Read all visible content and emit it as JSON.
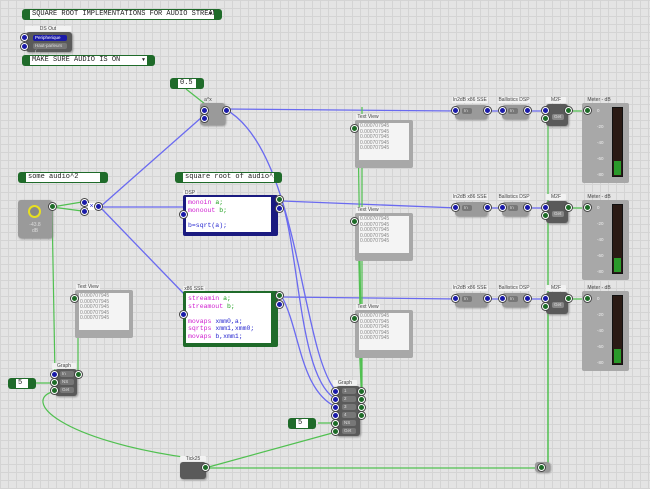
{
  "title_box": {
    "text": "SQUARE ROOT IMPLEMENTATIONS FOR AUDIO STREAMS"
  },
  "ds_out": {
    "label": "DS Out",
    "options": [
      "Peripherique ...",
      "Haut-parleurs (..."
    ]
  },
  "reminder": {
    "text": "MAKE SURE AUDIO IS ON"
  },
  "float_input": {
    "value": "0.5"
  },
  "power_node": {
    "label": "a^x"
  },
  "input_label": {
    "text": "some audio^2"
  },
  "knob": {
    "value": "-43.8",
    "unit": "dB",
    "color": "#e8e020"
  },
  "multiply": {
    "symbol": "×"
  },
  "output_label": {
    "text": "square root of audio^2"
  },
  "dsp": {
    "label": "DSP",
    "lines": [
      [
        "monoin",
        "a;"
      ],
      [
        "monoout",
        "b;"
      ],
      [
        "",
        ""
      ],
      [
        "b=sqrt(a);",
        ""
      ]
    ]
  },
  "sse": {
    "label": "x86 SSE",
    "lines": [
      [
        "streamin",
        "a;"
      ],
      [
        "streamout",
        "b;"
      ],
      [
        "",
        ""
      ],
      [
        "movaps",
        "xmm0,a;"
      ],
      [
        "sqrtps",
        "xmm1,xmm0;"
      ],
      [
        "movaps",
        "b,xmm1;"
      ]
    ]
  },
  "text_view": {
    "label": "Text View",
    "values": [
      "0.000707945",
      "0.000707945",
      "0.000707945",
      "0.000707945",
      "0.000707945"
    ]
  },
  "graph_left": {
    "label": "Graph",
    "pins": [
      "In",
      "NS",
      "Get"
    ]
  },
  "graph_right": {
    "label": "Graph",
    "pins": [
      "1",
      "2",
      "3",
      "4",
      "NS",
      "Get"
    ]
  },
  "int_left": {
    "value": "5"
  },
  "int_right": {
    "value": "5"
  },
  "ticker": {
    "label": "Tick25"
  },
  "chain": {
    "ln2db": "ln2dB x86 SSE",
    "ballistics": "Ballistics DSP",
    "m2f": "M2F",
    "m2f_get": "Get",
    "in": "In"
  },
  "meter": {
    "label": "Meter - dB",
    "scale": [
      "0",
      "-20",
      "-40",
      "-60",
      "-80"
    ],
    "level_fraction": 0.2,
    "fill_color": "#2a9a2a"
  },
  "colors": {
    "stream_wire": "#6a6af0",
    "float_wire": "#50c050",
    "module_green": "#1f6b2a",
    "module_blue": "#1a1a80"
  }
}
